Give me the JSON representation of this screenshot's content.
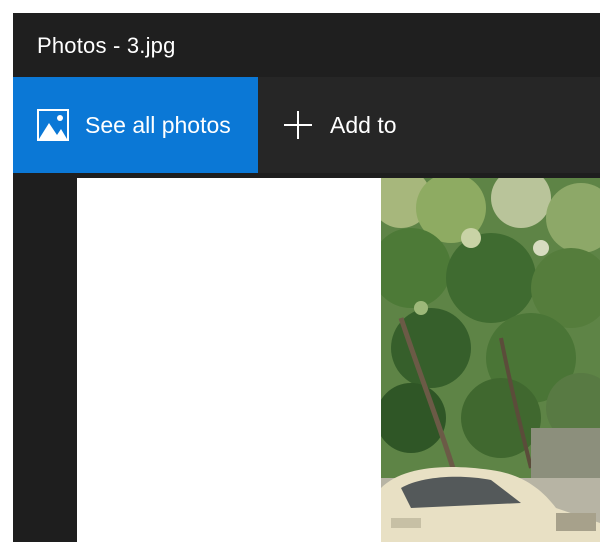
{
  "window": {
    "title": "Photos - 3.jpg"
  },
  "toolbar": {
    "see_all": {
      "label": "See all photos",
      "icon": "photos-icon"
    },
    "add_to": {
      "label": "Add to",
      "icon": "plus-icon"
    }
  },
  "colors": {
    "accent": "#0b78d6",
    "titlebar": "#1f1f1f",
    "toolbar": "#262626",
    "viewer_bg": "#1e1e1e"
  }
}
